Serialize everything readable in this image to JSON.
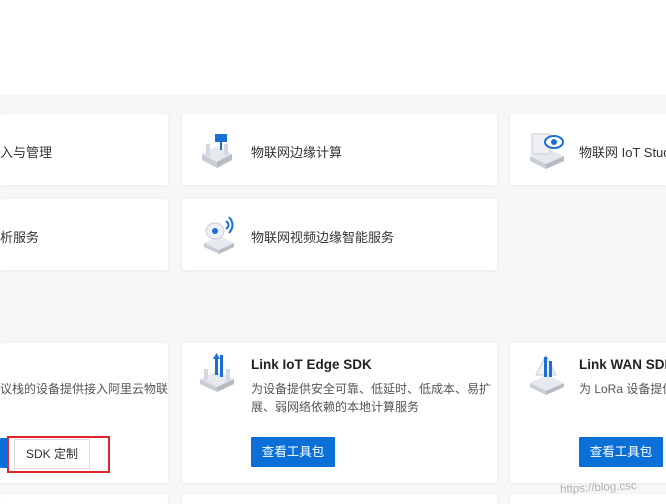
{
  "services": {
    "row1": [
      {
        "label": "入与管理"
      },
      {
        "label": "物联网边缘计算"
      },
      {
        "label": "物联网 IoT Stud"
      }
    ],
    "row2": [
      {
        "label": "析服务"
      },
      {
        "label": "物联网视频边缘智能服务"
      }
    ]
  },
  "sdks": [
    {
      "desc_line1": "议栈的设备提供接入阿里云物联",
      "secondary_button": "SDK 定制"
    },
    {
      "title": "Link IoT Edge SDK",
      "desc_line1": "为设备提供安全可靠、低延时、低成本、易扩",
      "desc_line2": "展、弱网络依赖的本地计算服务",
      "button": "查看工具包"
    },
    {
      "title": "Link WAN SDK",
      "desc_line1": "为 LoRa 设备提供",
      "button": "查看工具包"
    }
  ],
  "watermark": "https://blog.csc",
  "colors": {
    "accent": "#0a6fd6",
    "highlight": "#e0242b",
    "icon_blue": "#1a6ed8"
  }
}
